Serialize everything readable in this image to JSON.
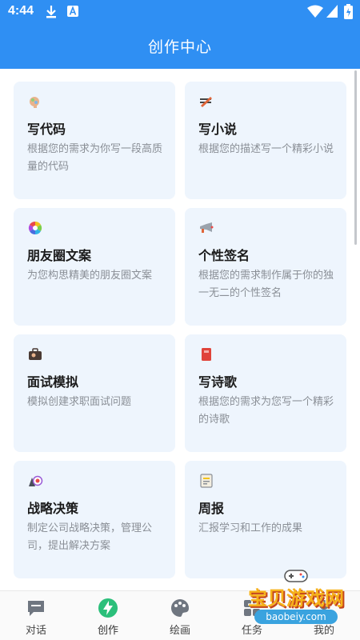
{
  "status_bar": {
    "time": "4:44"
  },
  "header": {
    "title": "创作中心"
  },
  "cards": [
    {
      "icon": "brain-icon",
      "title": "写代码",
      "desc": "根据您的需求为你写一段高质量的代码"
    },
    {
      "icon": "pencil-notes-icon",
      "title": "写小说",
      "desc": "根据您的描述写一个精彩小说"
    },
    {
      "icon": "color-wheel-icon",
      "title": "朋友圈文案",
      "desc": "为您构思精美的朋友圈文案"
    },
    {
      "icon": "megaphone-icon",
      "title": "个性签名",
      "desc": "根据您的需求制作属于你的独一无二的个性签名"
    },
    {
      "icon": "briefcase-icon",
      "title": "面试模拟",
      "desc": "模拟创建求职面试问题"
    },
    {
      "icon": "book-icon",
      "title": "写诗歌",
      "desc": "根据您的需求为您写一个精彩的诗歌"
    },
    {
      "icon": "target-chess-icon",
      "title": "战略决策",
      "desc": "制定公司战略决策，管理公司，提出解决方案"
    },
    {
      "icon": "report-icon",
      "title": "周报",
      "desc": "汇报学习和工作的成果"
    }
  ],
  "bottom_nav": [
    {
      "icon": "chat-icon",
      "label": "对话"
    },
    {
      "icon": "lightning-icon",
      "label": "创作",
      "active": true
    },
    {
      "icon": "palette-icon",
      "label": "绘画"
    },
    {
      "icon": "grid-icon",
      "label": "任务"
    },
    {
      "icon": "user-icon",
      "label": "我的"
    }
  ],
  "watermark": {
    "text": "宝贝游戏网",
    "url": "baobeiy.com"
  },
  "colors": {
    "primary": "#2f8ff3",
    "card_bg": "#eef5fd",
    "active_nav": "#2bbf7a"
  }
}
